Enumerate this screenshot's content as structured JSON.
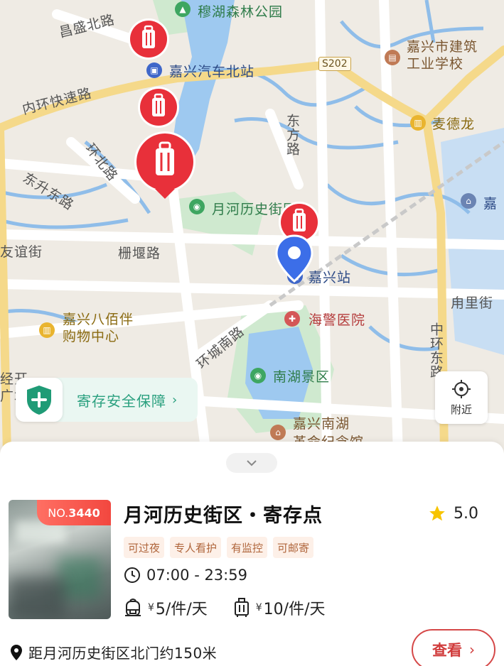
{
  "map": {
    "labels": {
      "park": "穆湖森林公园",
      "changsheng_north_road": "昌盛北路",
      "bus_station": "嘉兴汽车北站",
      "inner_ring_expressway": "内环快速路",
      "s202": "S202",
      "school": "嘉兴市建筑\n工业学校",
      "dongfang_road": "东方路",
      "mall_metro": "麦德龙",
      "huanbei_road": "环北路",
      "dongsheng_road": "东升东路",
      "yuehe_historic": "月河历史街区",
      "jia": "嘉",
      "youyi_street": "友谊街",
      "zhayan_road": "栅堰路",
      "jiaxing_station": "嘉兴站",
      "yongli_street": "甪里街",
      "bapaiban_mall": "嘉兴八佰伴\n购物中心",
      "police_hospital": "海警医院",
      "huancheng_south": "环城南路",
      "middle_ring_east": "中环东路",
      "nanhu_scenic": "南湖景区",
      "nanhu_memorial": "嘉兴南湖\n革命纪念馆",
      "kaichang": "经开\n广场"
    },
    "icons": [
      "tree-icon",
      "bus-icon",
      "school-icon",
      "mall-icon",
      "park-icon",
      "building-icon",
      "train-icon",
      "hospital-icon",
      "memorial-icon"
    ],
    "pin_color": "#e8303a",
    "location_color": "#3c6ee8"
  },
  "safety_banner": {
    "label": "寄存安全保障",
    "chevron": "›"
  },
  "nearby": {
    "label": "附近"
  },
  "store": {
    "badge_prefix": "NO.",
    "badge_number": "3440",
    "name": "月河历史街区・寄存点",
    "rating": "5.0",
    "tags": [
      "可过夜",
      "专人看护",
      "有监控",
      "可邮寄"
    ],
    "hours": "07:00 - 23:59",
    "prices": [
      {
        "icon": "backpack-icon",
        "currency": "¥",
        "text": "5/件/天"
      },
      {
        "icon": "suitcase-icon",
        "currency": "¥",
        "text": "10/件/天"
      }
    ],
    "distance": "距月河历史街区北门约150米",
    "view_label": "查看",
    "view_chevron": "›"
  },
  "colors": {
    "accent_red": "#d54848",
    "accent_green": "#2aa07f",
    "star": "#f7c400"
  }
}
